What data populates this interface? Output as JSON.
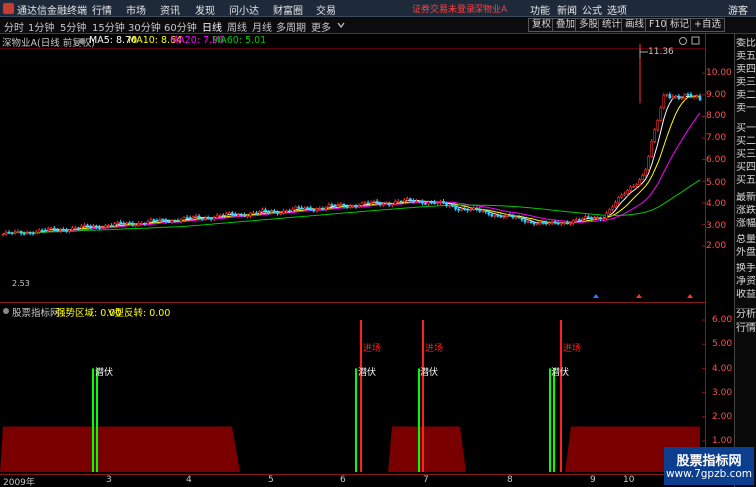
{
  "titlebar": {
    "app_name": "通达信金融终端",
    "menus": [
      "行情",
      "市场",
      "资讯",
      "发现",
      "问小达",
      "财富圈",
      "交易"
    ],
    "alert": "证券交易未登录",
    "stock_tag": "深物业A",
    "right_menus": [
      "功能",
      "新闻",
      "公式",
      "选项"
    ],
    "guest": "游客"
  },
  "periods": [
    "分时",
    "1分钟",
    "5分钟",
    "15分钟",
    "30分钟",
    "60分钟",
    "日线",
    "周线",
    "月线",
    "多周期",
    "更多"
  ],
  "active_period": "日线",
  "tools": [
    "复权",
    "叠加",
    "多股",
    "统计",
    "画线",
    "F10",
    "标记",
    "+自选"
  ],
  "chart_info": {
    "title": "深物业A(日线 前复权)",
    "ma5": "MA5: 8.70",
    "ma10": "MA10: 8.64",
    "ma20": "MA20: 7.96",
    "ma60": "MA60: 5.01",
    "high_label": "11.36",
    "low_label": "2.53"
  },
  "indicator_info": {
    "name": "股票指标网",
    "zone": "强势区域: 0.00",
    "vtype": "V型反转: 0.00"
  },
  "price_axis": [
    "10.00",
    "9.00",
    "8.00",
    "7.00",
    "6.00",
    "5.00",
    "4.00",
    "3.00",
    "2.00"
  ],
  "indicator_axis": [
    "6.00",
    "5.00",
    "4.00",
    "3.00",
    "2.00",
    "1.00"
  ],
  "date_axis": [
    "2009年",
    "3",
    "4",
    "5",
    "6",
    "7",
    "8",
    "9",
    "10"
  ],
  "signals": {
    "qianfu": "潜伏",
    "jinchang": "进场"
  },
  "side_panel": [
    "委比",
    "卖五",
    "卖四",
    "卖三",
    "卖二",
    "卖一",
    "买一",
    "买二",
    "买三",
    "买四",
    "买五",
    "最新",
    "涨跌",
    "涨幅",
    "总量",
    "外盘",
    "换手",
    "净资",
    "收益",
    "分析",
    "行情"
  ],
  "watermark": {
    "line1": "股票指标网",
    "line2": "www.7gpzb.com"
  },
  "colors": {
    "up": "#ff3232",
    "down": "#32d2ff",
    "ma5": "#ffffff",
    "ma10": "#ffff00",
    "ma20": "#ff00ff",
    "ma60": "#00c800",
    "band": "#7a0000",
    "signal_green": "#00ff00",
    "signal_red": "#ff2020"
  }
}
